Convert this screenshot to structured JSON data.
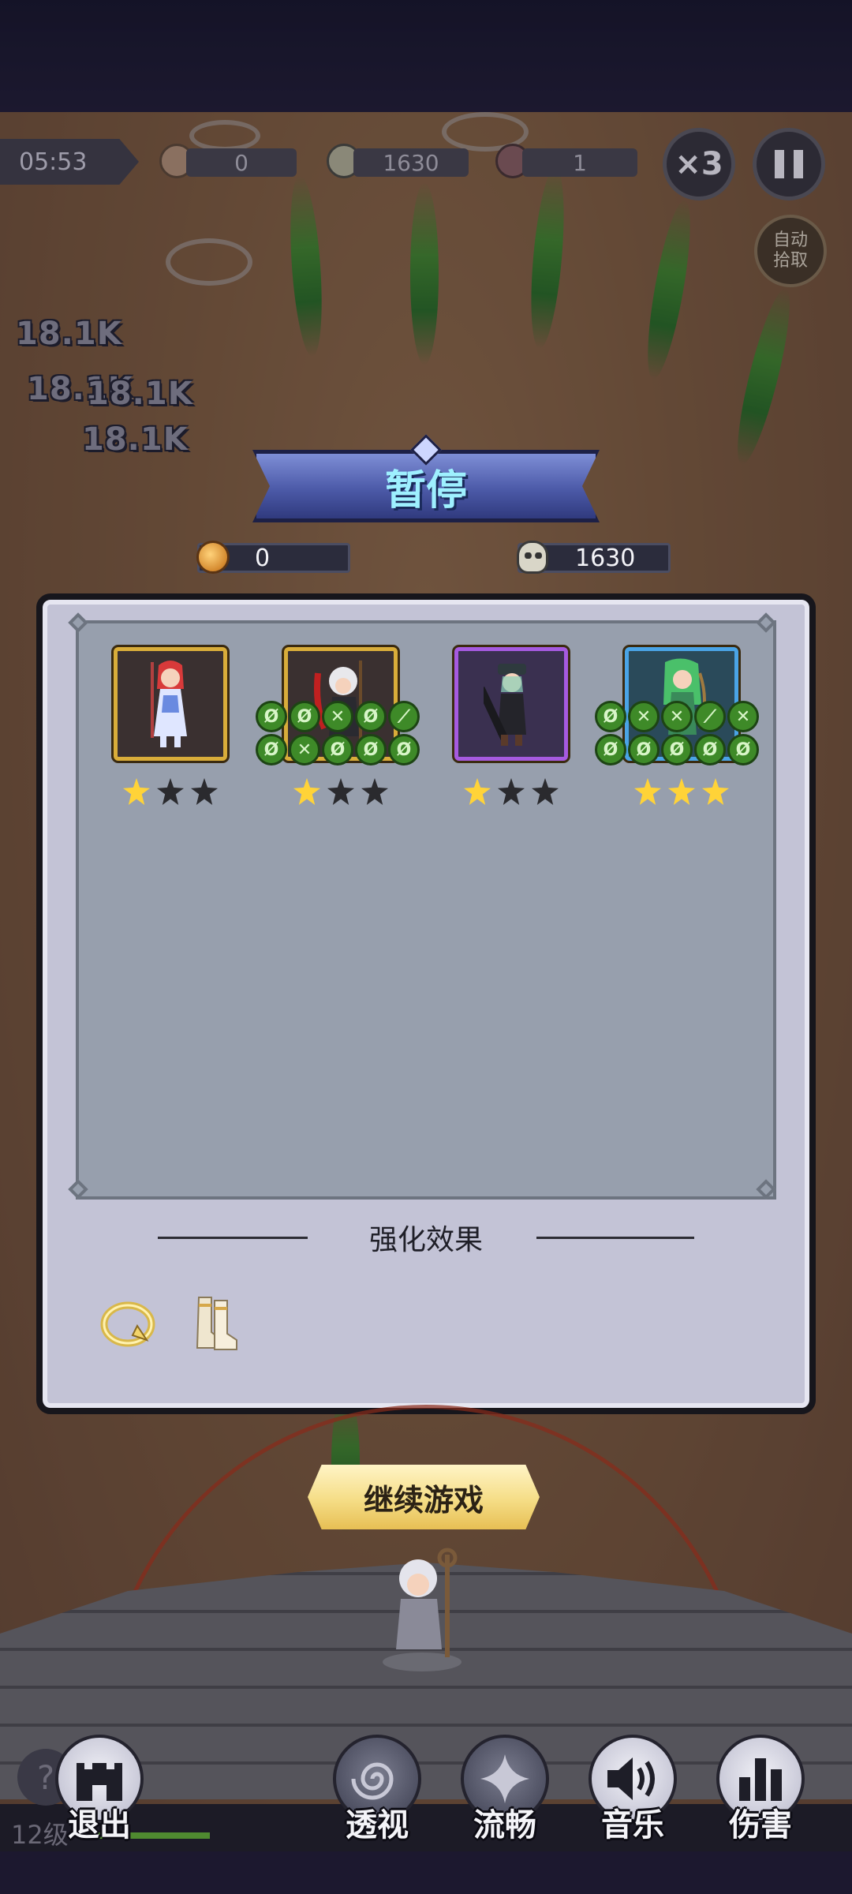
{
  "hud": {
    "timer": "05:53",
    "coins": "0",
    "kills": "1630",
    "bosses": "1",
    "speed_label": "×3",
    "pause_icon": "pause-icon",
    "auto_pickup_line1": "自动",
    "auto_pickup_line2": "拾取"
  },
  "damage_numbers": [
    "18.1K",
    "18.1K",
    "18.1K",
    "18.1K"
  ],
  "pause_panel": {
    "title": "暂停",
    "coins": "0",
    "kills": "1630",
    "heroes": [
      {
        "name": "red-haired-swordswoman",
        "frame": "gold",
        "stars": 1,
        "max_stars": 3,
        "skills": []
      },
      {
        "name": "white-haired-scythe-girl",
        "frame": "gold",
        "stars": 1,
        "max_stars": 3,
        "skills": [
          "Ø",
          "Ø",
          "✕",
          "Ø",
          "⟋",
          "Ø",
          "✕",
          "Ø",
          "Ø",
          "Ø"
        ]
      },
      {
        "name": "gunner-with-cap",
        "frame": "purple",
        "stars": 1,
        "max_stars": 3,
        "skills": []
      },
      {
        "name": "green-haired-archer",
        "frame": "blue",
        "stars": 3,
        "max_stars": 3,
        "skills": [
          "Ø",
          "✕",
          "✕",
          "⟋",
          "✕",
          "Ø",
          "Ø",
          "Ø",
          "Ø",
          "Ø"
        ]
      }
    ],
    "buff_section_title": "强化效果",
    "buffs": [
      "ring-icon",
      "boots-icon"
    ],
    "continue_label": "继续游戏"
  },
  "bottom_bar": {
    "level": "12级",
    "help": "?",
    "buttons": [
      {
        "label": "退出",
        "icon": "castle-icon"
      },
      {
        "label": "透视",
        "icon": "swirl-icon"
      },
      {
        "label": "流畅",
        "icon": "sparkle-icon"
      },
      {
        "label": "音乐",
        "icon": "speaker-icon"
      },
      {
        "label": "伤害",
        "icon": "bar-chart-icon"
      }
    ]
  },
  "colors": {
    "banner_text": "#9ef0ff",
    "star_on": "#ffd338",
    "skill_green": "#3e8a28",
    "continue_button": "#f5dd86"
  }
}
